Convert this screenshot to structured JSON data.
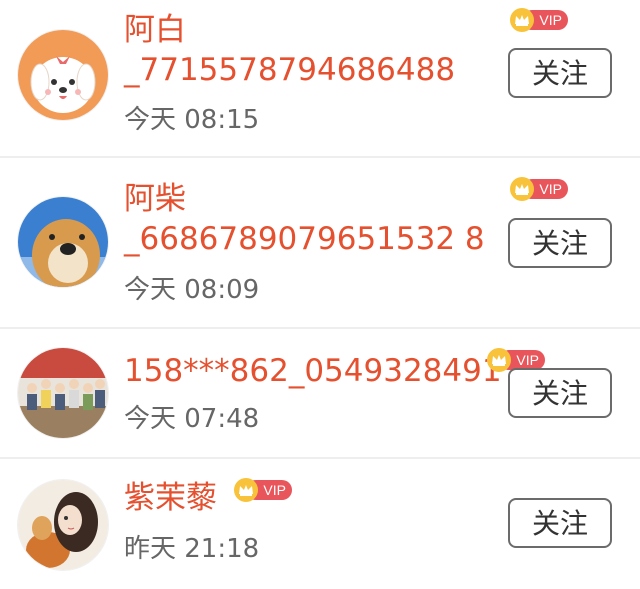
{
  "follow_list": {
    "users": [
      {
        "name_line1": "阿白",
        "name_line2": "_7715578794686488",
        "time": "今天 08:15",
        "vip": true,
        "follow_label": "关注",
        "avatar_icon": "cartoon-dog-avatar-icon"
      },
      {
        "name_line1": "阿柴",
        "name_line2": "_6686789079651532 8",
        "time": "今天 08:09",
        "vip": true,
        "follow_label": "关注",
        "avatar_icon": "shiba-avatar-icon"
      },
      {
        "name_line1": "158***862_0549328491",
        "time": "今天 07:48",
        "vip": true,
        "follow_label": "关注",
        "avatar_icon": "group-photo-avatar-icon"
      },
      {
        "name_line1": "紫茉藜",
        "time": "昨天 21:18",
        "vip": true,
        "follow_label": "关注",
        "avatar_icon": "girl-illustration-avatar-icon"
      }
    ],
    "vip_text": "VIP",
    "colors": {
      "name": "#e5502f",
      "vip_badge": "#e8555a",
      "crown": "#f8c33a"
    }
  }
}
